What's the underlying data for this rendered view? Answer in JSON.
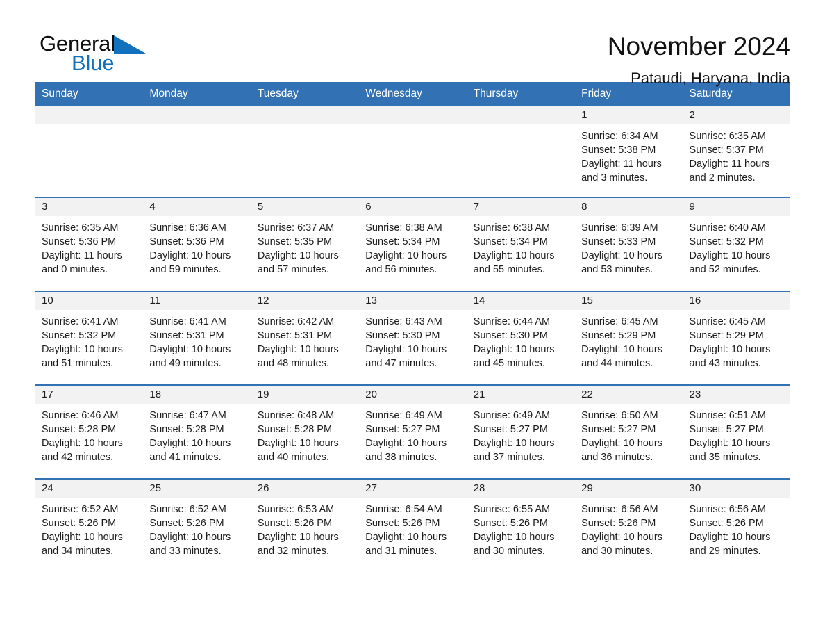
{
  "brand": {
    "name_part1": "General",
    "name_part2": "Blue",
    "triangle_color": "#1271bd"
  },
  "header": {
    "title": "November 2024",
    "location": "Pataudi, Haryana, India",
    "accent_color": "#3272b4"
  },
  "weekday_headers": [
    "Sunday",
    "Monday",
    "Tuesday",
    "Wednesday",
    "Thursday",
    "Friday",
    "Saturday"
  ],
  "weeks": [
    [
      {
        "day": "",
        "sunrise": "",
        "sunset": "",
        "daylight_line1": "",
        "daylight_line2": ""
      },
      {
        "day": "",
        "sunrise": "",
        "sunset": "",
        "daylight_line1": "",
        "daylight_line2": ""
      },
      {
        "day": "",
        "sunrise": "",
        "sunset": "",
        "daylight_line1": "",
        "daylight_line2": ""
      },
      {
        "day": "",
        "sunrise": "",
        "sunset": "",
        "daylight_line1": "",
        "daylight_line2": ""
      },
      {
        "day": "",
        "sunrise": "",
        "sunset": "",
        "daylight_line1": "",
        "daylight_line2": ""
      },
      {
        "day": "1",
        "sunrise": "Sunrise: 6:34 AM",
        "sunset": "Sunset: 5:38 PM",
        "daylight_line1": "Daylight: 11 hours",
        "daylight_line2": "and 3 minutes."
      },
      {
        "day": "2",
        "sunrise": "Sunrise: 6:35 AM",
        "sunset": "Sunset: 5:37 PM",
        "daylight_line1": "Daylight: 11 hours",
        "daylight_line2": "and 2 minutes."
      }
    ],
    [
      {
        "day": "3",
        "sunrise": "Sunrise: 6:35 AM",
        "sunset": "Sunset: 5:36 PM",
        "daylight_line1": "Daylight: 11 hours",
        "daylight_line2": "and 0 minutes."
      },
      {
        "day": "4",
        "sunrise": "Sunrise: 6:36 AM",
        "sunset": "Sunset: 5:36 PM",
        "daylight_line1": "Daylight: 10 hours",
        "daylight_line2": "and 59 minutes."
      },
      {
        "day": "5",
        "sunrise": "Sunrise: 6:37 AM",
        "sunset": "Sunset: 5:35 PM",
        "daylight_line1": "Daylight: 10 hours",
        "daylight_line2": "and 57 minutes."
      },
      {
        "day": "6",
        "sunrise": "Sunrise: 6:38 AM",
        "sunset": "Sunset: 5:34 PM",
        "daylight_line1": "Daylight: 10 hours",
        "daylight_line2": "and 56 minutes."
      },
      {
        "day": "7",
        "sunrise": "Sunrise: 6:38 AM",
        "sunset": "Sunset: 5:34 PM",
        "daylight_line1": "Daylight: 10 hours",
        "daylight_line2": "and 55 minutes."
      },
      {
        "day": "8",
        "sunrise": "Sunrise: 6:39 AM",
        "sunset": "Sunset: 5:33 PM",
        "daylight_line1": "Daylight: 10 hours",
        "daylight_line2": "and 53 minutes."
      },
      {
        "day": "9",
        "sunrise": "Sunrise: 6:40 AM",
        "sunset": "Sunset: 5:32 PM",
        "daylight_line1": "Daylight: 10 hours",
        "daylight_line2": "and 52 minutes."
      }
    ],
    [
      {
        "day": "10",
        "sunrise": "Sunrise: 6:41 AM",
        "sunset": "Sunset: 5:32 PM",
        "daylight_line1": "Daylight: 10 hours",
        "daylight_line2": "and 51 minutes."
      },
      {
        "day": "11",
        "sunrise": "Sunrise: 6:41 AM",
        "sunset": "Sunset: 5:31 PM",
        "daylight_line1": "Daylight: 10 hours",
        "daylight_line2": "and 49 minutes."
      },
      {
        "day": "12",
        "sunrise": "Sunrise: 6:42 AM",
        "sunset": "Sunset: 5:31 PM",
        "daylight_line1": "Daylight: 10 hours",
        "daylight_line2": "and 48 minutes."
      },
      {
        "day": "13",
        "sunrise": "Sunrise: 6:43 AM",
        "sunset": "Sunset: 5:30 PM",
        "daylight_line1": "Daylight: 10 hours",
        "daylight_line2": "and 47 minutes."
      },
      {
        "day": "14",
        "sunrise": "Sunrise: 6:44 AM",
        "sunset": "Sunset: 5:30 PM",
        "daylight_line1": "Daylight: 10 hours",
        "daylight_line2": "and 45 minutes."
      },
      {
        "day": "15",
        "sunrise": "Sunrise: 6:45 AM",
        "sunset": "Sunset: 5:29 PM",
        "daylight_line1": "Daylight: 10 hours",
        "daylight_line2": "and 44 minutes."
      },
      {
        "day": "16",
        "sunrise": "Sunrise: 6:45 AM",
        "sunset": "Sunset: 5:29 PM",
        "daylight_line1": "Daylight: 10 hours",
        "daylight_line2": "and 43 minutes."
      }
    ],
    [
      {
        "day": "17",
        "sunrise": "Sunrise: 6:46 AM",
        "sunset": "Sunset: 5:28 PM",
        "daylight_line1": "Daylight: 10 hours",
        "daylight_line2": "and 42 minutes."
      },
      {
        "day": "18",
        "sunrise": "Sunrise: 6:47 AM",
        "sunset": "Sunset: 5:28 PM",
        "daylight_line1": "Daylight: 10 hours",
        "daylight_line2": "and 41 minutes."
      },
      {
        "day": "19",
        "sunrise": "Sunrise: 6:48 AM",
        "sunset": "Sunset: 5:28 PM",
        "daylight_line1": "Daylight: 10 hours",
        "daylight_line2": "and 40 minutes."
      },
      {
        "day": "20",
        "sunrise": "Sunrise: 6:49 AM",
        "sunset": "Sunset: 5:27 PM",
        "daylight_line1": "Daylight: 10 hours",
        "daylight_line2": "and 38 minutes."
      },
      {
        "day": "21",
        "sunrise": "Sunrise: 6:49 AM",
        "sunset": "Sunset: 5:27 PM",
        "daylight_line1": "Daylight: 10 hours",
        "daylight_line2": "and 37 minutes."
      },
      {
        "day": "22",
        "sunrise": "Sunrise: 6:50 AM",
        "sunset": "Sunset: 5:27 PM",
        "daylight_line1": "Daylight: 10 hours",
        "daylight_line2": "and 36 minutes."
      },
      {
        "day": "23",
        "sunrise": "Sunrise: 6:51 AM",
        "sunset": "Sunset: 5:27 PM",
        "daylight_line1": "Daylight: 10 hours",
        "daylight_line2": "and 35 minutes."
      }
    ],
    [
      {
        "day": "24",
        "sunrise": "Sunrise: 6:52 AM",
        "sunset": "Sunset: 5:26 PM",
        "daylight_line1": "Daylight: 10 hours",
        "daylight_line2": "and 34 minutes."
      },
      {
        "day": "25",
        "sunrise": "Sunrise: 6:52 AM",
        "sunset": "Sunset: 5:26 PM",
        "daylight_line1": "Daylight: 10 hours",
        "daylight_line2": "and 33 minutes."
      },
      {
        "day": "26",
        "sunrise": "Sunrise: 6:53 AM",
        "sunset": "Sunset: 5:26 PM",
        "daylight_line1": "Daylight: 10 hours",
        "daylight_line2": "and 32 minutes."
      },
      {
        "day": "27",
        "sunrise": "Sunrise: 6:54 AM",
        "sunset": "Sunset: 5:26 PM",
        "daylight_line1": "Daylight: 10 hours",
        "daylight_line2": "and 31 minutes."
      },
      {
        "day": "28",
        "sunrise": "Sunrise: 6:55 AM",
        "sunset": "Sunset: 5:26 PM",
        "daylight_line1": "Daylight: 10 hours",
        "daylight_line2": "and 30 minutes."
      },
      {
        "day": "29",
        "sunrise": "Sunrise: 6:56 AM",
        "sunset": "Sunset: 5:26 PM",
        "daylight_line1": "Daylight: 10 hours",
        "daylight_line2": "and 30 minutes."
      },
      {
        "day": "30",
        "sunrise": "Sunrise: 6:56 AM",
        "sunset": "Sunset: 5:26 PM",
        "daylight_line1": "Daylight: 10 hours",
        "daylight_line2": "and 29 minutes."
      }
    ]
  ]
}
